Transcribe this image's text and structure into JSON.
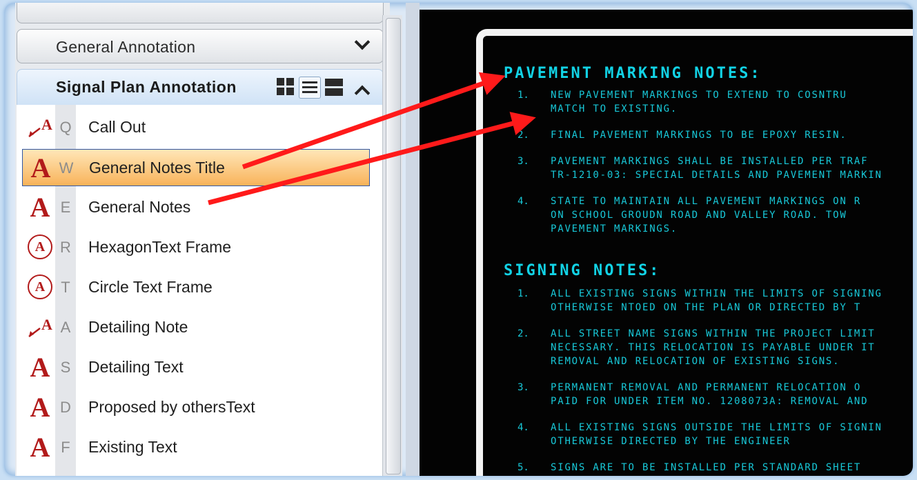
{
  "panel": {
    "group_header": "General Annotation",
    "active_header": "Signal Plan Annotation",
    "items": [
      {
        "icon": "callout-icon",
        "key": "Q",
        "label": "Call Out"
      },
      {
        "icon": "text-a-icon",
        "key": "W",
        "label": "General Notes Title",
        "selected": true
      },
      {
        "icon": "text-a-icon",
        "key": "E",
        "label": "General Notes"
      },
      {
        "icon": "circle-a-icon",
        "key": "R",
        "label": "HexagonText Frame"
      },
      {
        "icon": "circle-a-icon",
        "key": "T",
        "label": "Circle Text Frame"
      },
      {
        "icon": "callout-icon",
        "key": "A",
        "label": "Detailing Note"
      },
      {
        "icon": "text-a-icon",
        "key": "S",
        "label": "Detailing Text"
      },
      {
        "icon": "text-a-icon",
        "key": "D",
        "label": "Proposed by othersText"
      },
      {
        "icon": "text-a-icon",
        "key": "F",
        "label": "Existing Text"
      }
    ]
  },
  "cad": {
    "title1": "PAVEMENT MARKING NOTES:",
    "pm_notes": [
      {
        "num": "1.",
        "lines": [
          "NEW PAVEMENT MARKINGS TO EXTEND TO COSNTRU",
          "MATCH TO EXISTING."
        ]
      },
      {
        "num": "2.",
        "lines": [
          "FINAL PAVEMENT MARKINGS TO BE EPOXY RESIN."
        ]
      },
      {
        "num": "3.",
        "lines": [
          "PAVEMENT MARKINGS SHALL BE INSTALLED PER TRAF",
          "TR-1210-03: SPECIAL DETAILS AND PAVEMENT MARKIN"
        ]
      },
      {
        "num": "4.",
        "lines": [
          "STATE TO MAINTAIN ALL PAVEMENT MARKINGS ON R",
          "ON SCHOOL GROUDN ROAD AND VALLEY ROAD. TOW",
          "PAVEMENT MARKINGS."
        ]
      }
    ],
    "title2": "SIGNING NOTES:",
    "sign_notes": [
      {
        "num": "1.",
        "lines": [
          "ALL EXISTING SIGNS WITHIN THE LIMITS OF SIGNING",
          "OTHERWISE NTOED ON THE PLAN OR DIRECTED BY T"
        ]
      },
      {
        "num": "2.",
        "lines": [
          "ALL STREET NAME SIGNS WITHIN THE PROJECT LIMIT",
          "NECESSARY. THIS RELOCATION IS PAYABLE UNDER IT",
          "REMOVAL AND RELOCATION OF EXISTING SIGNS."
        ]
      },
      {
        "num": "3.",
        "lines": [
          "PERMANENT REMOVAL AND PERMANENT RELOCATION O",
          "PAID FOR UNDER ITEM NO. 1208073A: REMOVAL AND"
        ]
      },
      {
        "num": "4.",
        "lines": [
          "ALL EXISTING SIGNS OUTSIDE THE LIMITS OF SIGNIN",
          "OTHERWISE DIRECTED BY THE ENGINEER"
        ]
      },
      {
        "num": "5.",
        "lines": [
          "SIGNS ARE TO BE INSTALLED PER STANDARD SHEET"
        ]
      }
    ]
  },
  "colors": {
    "arrow": "#ff1a1a",
    "cad_text": "#18c9d9",
    "icon_red": "#b21a1a",
    "selection": "#f8b35a"
  }
}
